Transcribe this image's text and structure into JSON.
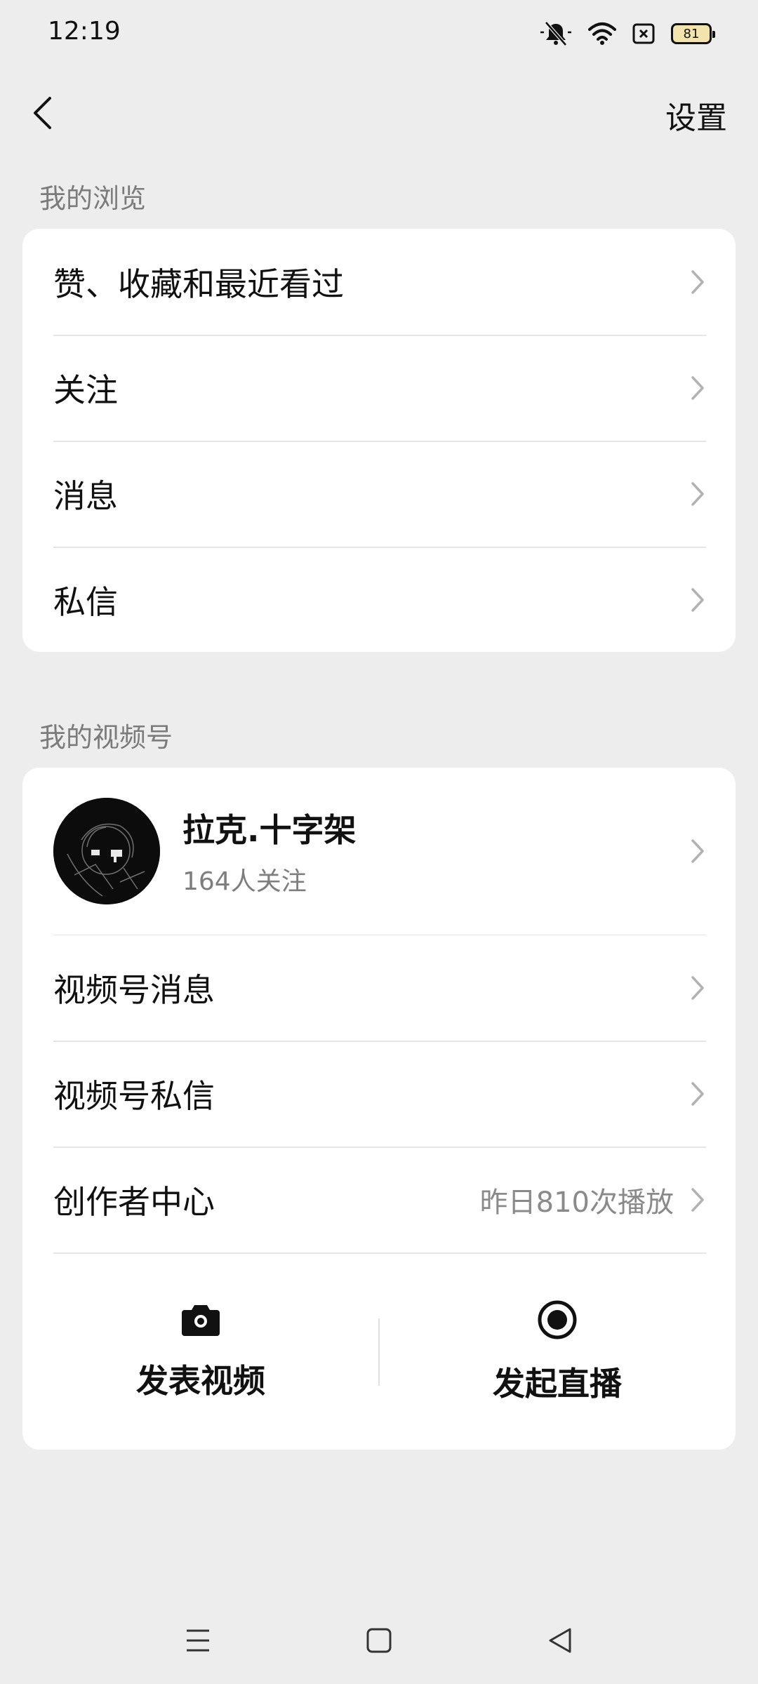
{
  "status_bar": {
    "time": "12:19",
    "battery": "81",
    "icons": [
      "mute-bell-icon",
      "wifi-icon",
      "sim-x-icon",
      "battery-icon"
    ]
  },
  "nav": {
    "settings_label": "设置",
    "back_icon": "chevron-left-icon"
  },
  "browse": {
    "title": "我的浏览",
    "items": [
      {
        "label": "赞、收藏和最近看过"
      },
      {
        "label": "关注"
      },
      {
        "label": "消息"
      },
      {
        "label": "私信"
      }
    ]
  },
  "channels": {
    "title": "我的视频号",
    "profile": {
      "name": "拉克.十字架",
      "followers": "164人关注"
    },
    "items": [
      {
        "label": "视频号消息",
        "extra": ""
      },
      {
        "label": "视频号私信",
        "extra": ""
      },
      {
        "label": "创作者中心",
        "extra": "昨日810次播放"
      }
    ],
    "actions": [
      {
        "label": "发表视频",
        "icon": "camera-icon"
      },
      {
        "label": "发起直播",
        "icon": "live-record-icon"
      }
    ]
  },
  "system_nav": [
    "menu-icon",
    "home-square-icon",
    "back-triangle-icon"
  ],
  "colors": {
    "background": "#ededed",
    "card": "#ffffff",
    "secondary_text": "#7b7b7b",
    "battery_fill": "#f3e3ad"
  }
}
